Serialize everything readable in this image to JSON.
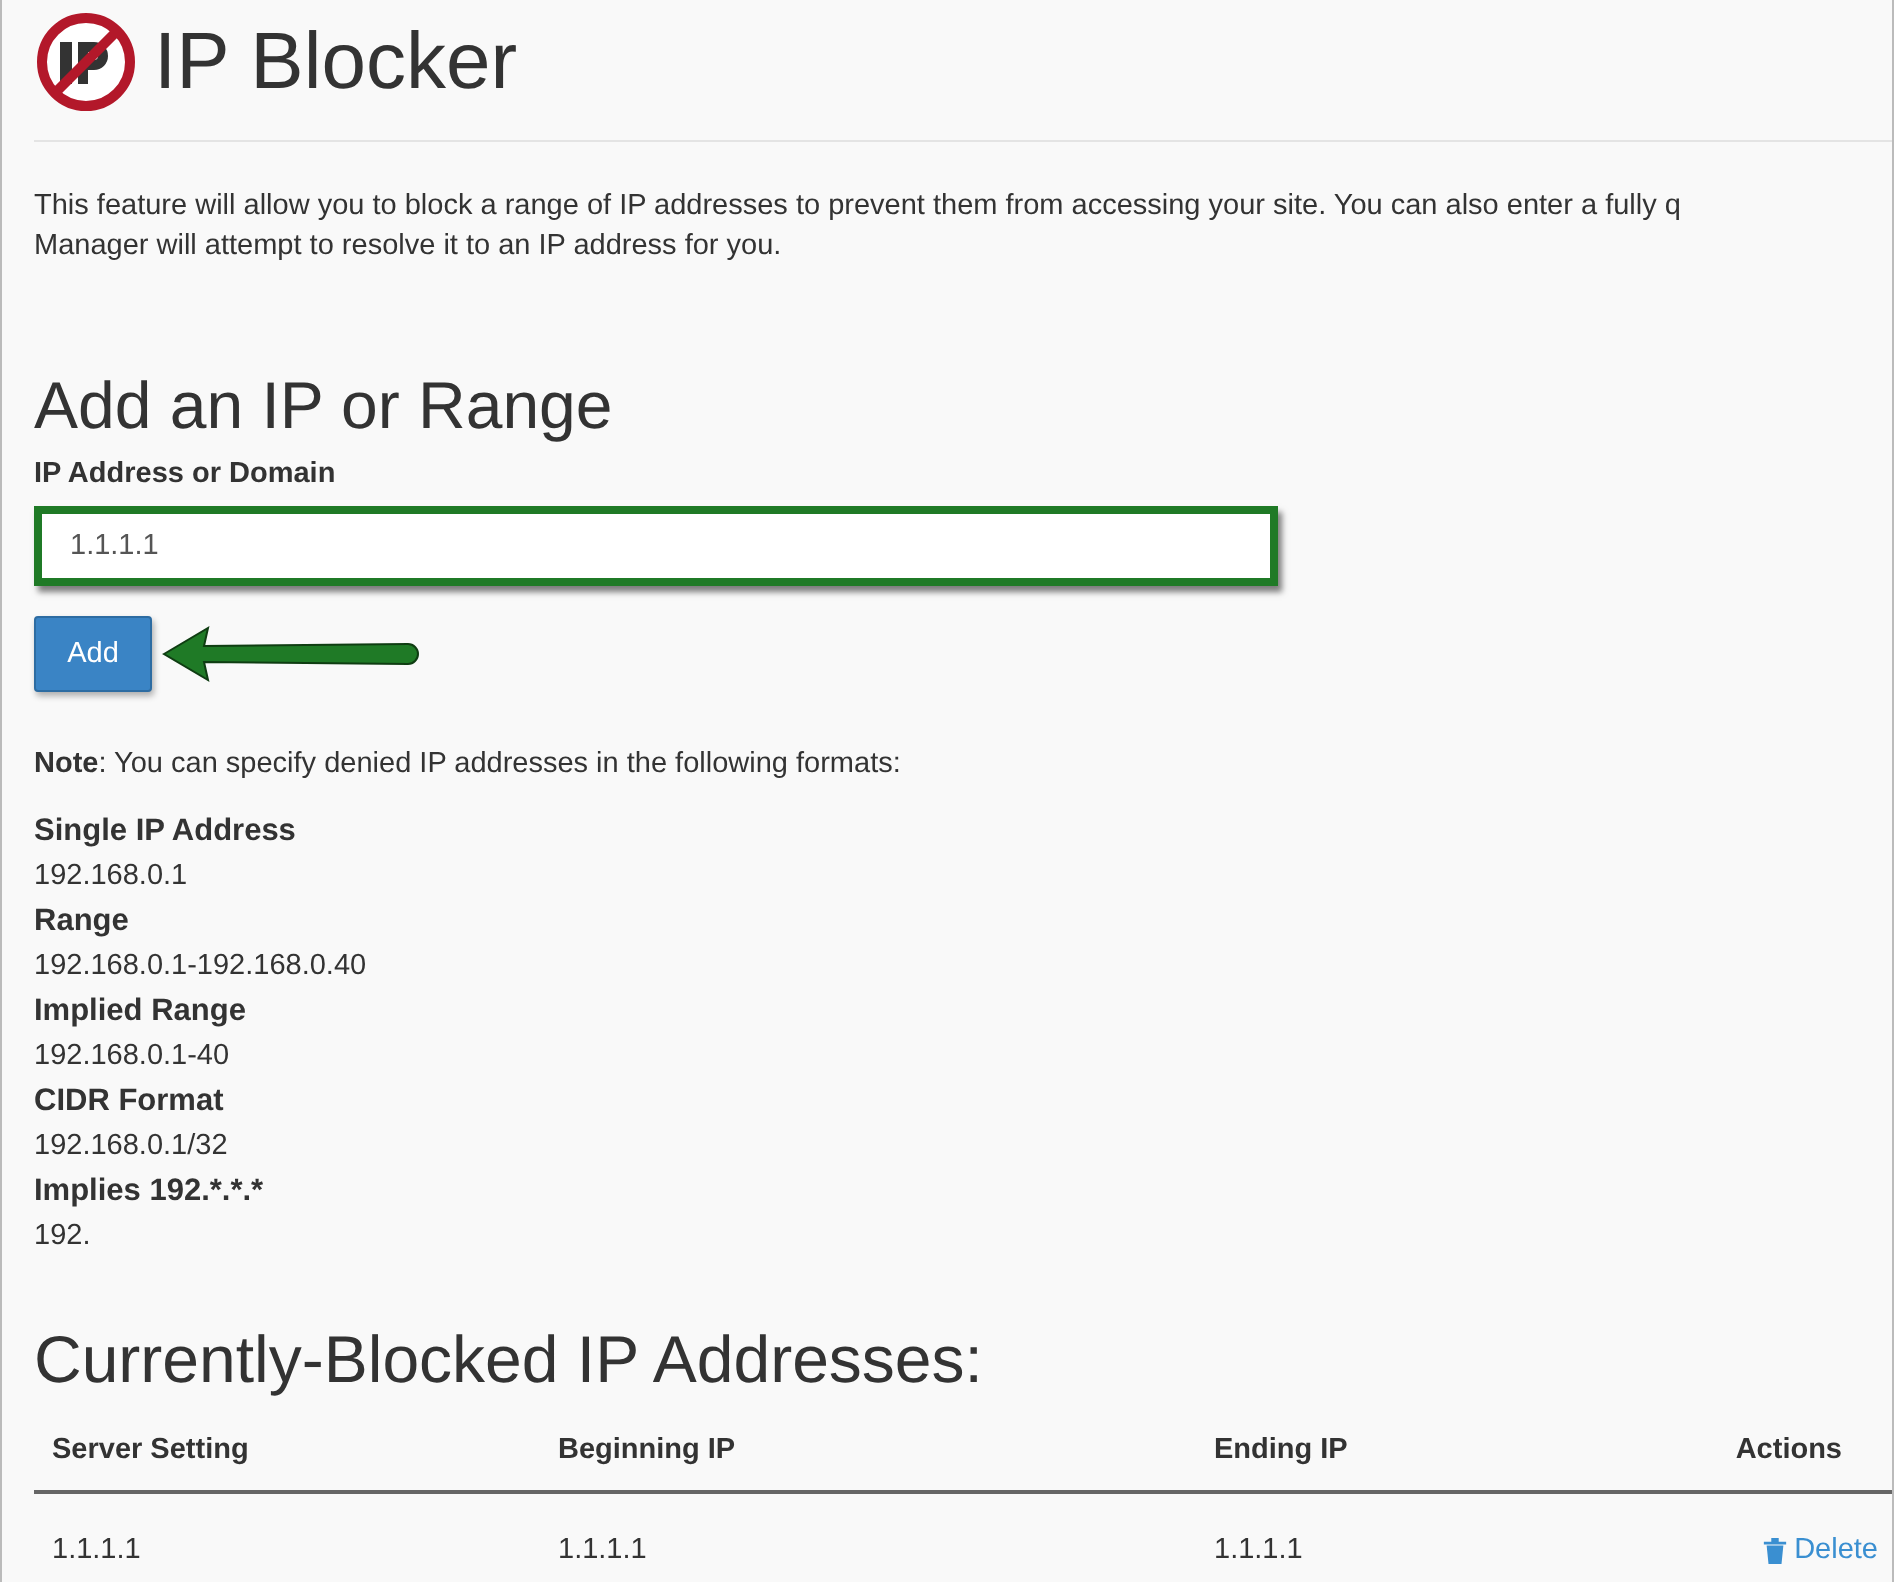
{
  "page": {
    "title": "IP Blocker",
    "description_lines": [
      "This feature will allow you to block a range of IP addresses to prevent them from accessing your site. You can also enter a fully q",
      "Manager will attempt to resolve it to an IP address for you."
    ]
  },
  "add_form": {
    "heading": "Add an IP or Range",
    "field_label": "IP Address or Domain",
    "value": "1.1.1.1",
    "highlighted": true,
    "button": "Add",
    "arrow": true
  },
  "note": {
    "text": "**Note**: You can specify denied IP addresses in the following formats:",
    "formats": [
      {
        "name": "Single IP Address",
        "example": "192.168.0.1"
      },
      {
        "name": "Range",
        "example": "192.168.0.1-192.168.0.40"
      },
      {
        "name": "Implied Range",
        "example": "192.168.0.1-40"
      },
      {
        "name": "CIDR Format",
        "example": "192.168.0.1/32"
      },
      {
        "name": "Implies 192.*.*.*",
        "example": "192."
      }
    ]
  },
  "blocked": {
    "heading": "Currently-Blocked IP Addresses:",
    "columns": [
      "Server Setting",
      "Beginning IP",
      "Ending IP",
      "Actions"
    ],
    "rows": [
      {
        "server_setting": "1.1.1.1",
        "beginning_ip": "1.1.1.1",
        "ending_ip": "1.1.1.1",
        "action": "Delete"
      }
    ]
  }
}
